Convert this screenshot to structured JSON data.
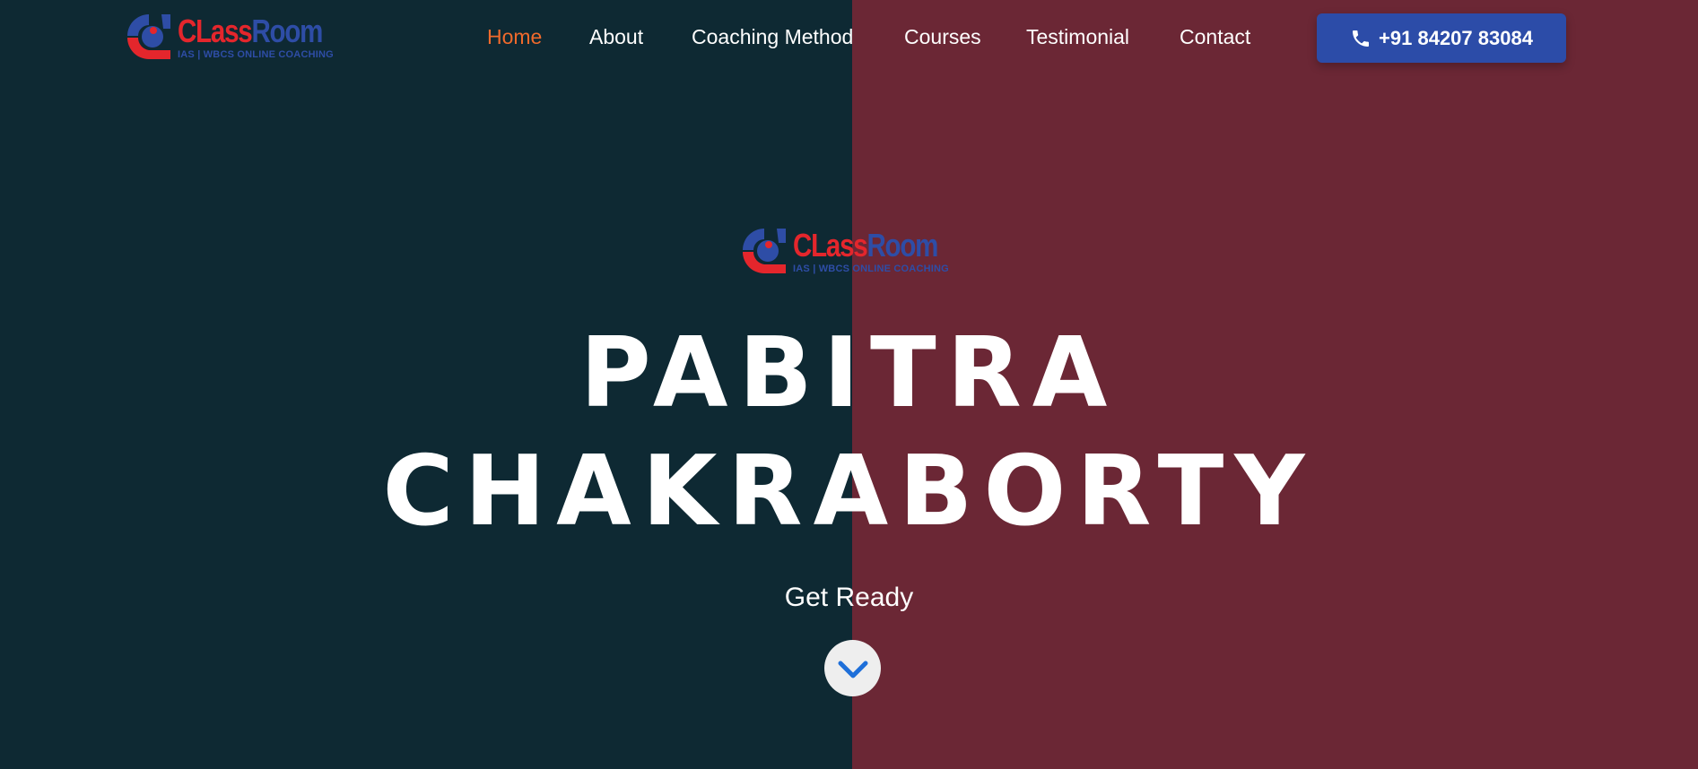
{
  "brand": {
    "logo_title_part1": "CLass",
    "logo_title_part2": "Room",
    "logo_subtitle": "IAS | WBCS  ONLINE COACHING",
    "logo_icon": "classroom-logo-icon"
  },
  "nav": {
    "items": [
      {
        "label": "Home",
        "active": true
      },
      {
        "label": "About",
        "active": false
      },
      {
        "label": "Coaching Method",
        "active": false
      },
      {
        "label": "Courses",
        "active": false
      },
      {
        "label": "Testimonial",
        "active": false
      },
      {
        "label": "Contact",
        "active": false
      }
    ]
  },
  "contact": {
    "phone_label": "+91 84207 83084",
    "icon": "phone-icon"
  },
  "hero": {
    "name_line1": "PABITRA",
    "name_line2": "CHAKRABORTY",
    "tagline": "Get Ready",
    "scroll_icon": "chevron-down-icon"
  },
  "colors": {
    "left_bg": "#0e2933",
    "right_bg": "#6b2735",
    "accent_active": "#f06a2c",
    "button_blue": "#2c4ca8",
    "logo_red": "#e4262c",
    "logo_blue": "#2e4da6"
  }
}
